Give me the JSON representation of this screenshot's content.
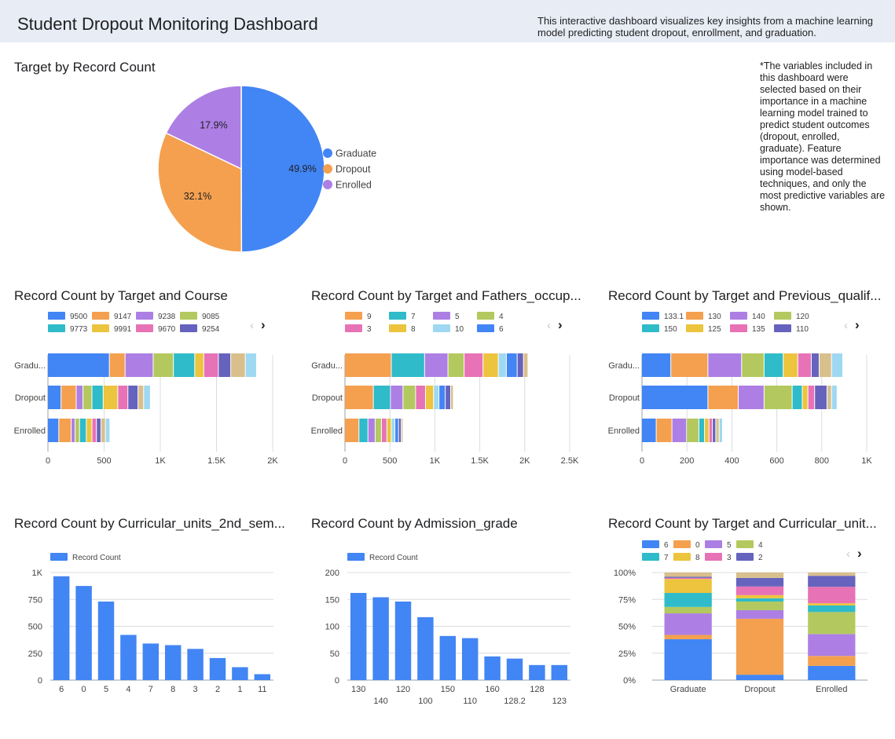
{
  "header": {
    "title": "Student Dropout Monitoring Dashboard",
    "description": "This interactive dashboard visualizes key insights from a machine learning model predicting student dropout, enrollment, and graduation."
  },
  "note": "*The variables included in this dashboard were selected based on their importance in a machine learning model trained to predict student outcomes (dropout, enrolled, graduate). Feature importance was determined using model-based techniques, and only the most predictive variables are shown.",
  "colors": {
    "blue": "#4285f4",
    "orange": "#f4a04f",
    "purple": "#ad7fe4",
    "olive": "#b3c95f",
    "teal": "#2fbbc9",
    "yellow": "#ecc43d",
    "pink": "#e772b6",
    "indigo": "#6563bd",
    "tan": "#d9bf8c",
    "lightblue": "#9fd8f2"
  },
  "chart_data": [
    {
      "id": "target_pie",
      "type": "pie",
      "title": "Target by Record Count",
      "slices": [
        {
          "label": "Graduate",
          "value": 49.9,
          "display": "49.9%",
          "color": "#4285f4"
        },
        {
          "label": "Dropout",
          "value": 32.1,
          "display": "32.1%",
          "color": "#f4a04f"
        },
        {
          "label": "Enrolled",
          "value": 17.9,
          "display": "17.9%",
          "color": "#ad7fe4"
        }
      ]
    },
    {
      "id": "course",
      "type": "bar",
      "stacked": true,
      "orientation": "horizontal",
      "title": "Record Count by Target and Course",
      "categories": [
        "Gradu...",
        "Dropout",
        "Enrolled"
      ],
      "ticks": [
        "0",
        "500",
        "1K",
        "1.5K",
        "2K"
      ],
      "xlim": [
        0,
        2000
      ],
      "legend": [
        "9500",
        "9147",
        "9238",
        "9085",
        "9773",
        "9991",
        "9670",
        "9254"
      ],
      "series": [
        {
          "name": "9500",
          "color": "#4285f4",
          "values": [
            550,
            120,
            100
          ]
        },
        {
          "name": "9147",
          "color": "#f4a04f",
          "values": [
            140,
            135,
            110
          ]
        },
        {
          "name": "9238",
          "color": "#ad7fe4",
          "values": [
            250,
            60,
            35
          ]
        },
        {
          "name": "9085",
          "color": "#b3c95f",
          "values": [
            180,
            80,
            40
          ]
        },
        {
          "name": "9773",
          "color": "#2fbbc9",
          "values": [
            190,
            100,
            60
          ]
        },
        {
          "name": "9991",
          "color": "#ecc43d",
          "values": [
            80,
            130,
            50
          ]
        },
        {
          "name": "9670",
          "color": "#e772b6",
          "values": [
            130,
            90,
            40
          ]
        },
        {
          "name": "9254",
          "color": "#6563bd",
          "values": [
            110,
            90,
            40
          ]
        },
        {
          "color": "#d9bf8c",
          "values": [
            130,
            50,
            40
          ]
        },
        {
          "color": "#9fd8f2",
          "values": [
            100,
            60,
            40
          ]
        }
      ]
    },
    {
      "id": "fathers",
      "type": "bar",
      "stacked": true,
      "orientation": "horizontal",
      "title": "Record Count by Target and Fathers_occup...",
      "categories": [
        "Gradu...",
        "Dropout",
        "Enrolled"
      ],
      "ticks": [
        "0",
        "500",
        "1K",
        "1.5K",
        "2K",
        "2.5K"
      ],
      "xlim": [
        0,
        2500
      ],
      "legend": [
        "9",
        "7",
        "5",
        "4",
        "3",
        "8",
        "10",
        "6"
      ],
      "series": [
        {
          "name": "9",
          "color": "#f4a04f",
          "values": [
            520,
            320,
            160
          ]
        },
        {
          "name": "7",
          "color": "#2fbbc9",
          "values": [
            370,
            190,
            100
          ]
        },
        {
          "name": "5",
          "color": "#ad7fe4",
          "values": [
            260,
            140,
            80
          ]
        },
        {
          "name": "4",
          "color": "#b3c95f",
          "values": [
            180,
            140,
            70
          ]
        },
        {
          "name": "3",
          "color": "#e772b6",
          "values": [
            210,
            110,
            60
          ]
        },
        {
          "name": "8",
          "color": "#ecc43d",
          "values": [
            170,
            90,
            50
          ]
        },
        {
          "name": "10",
          "color": "#9fd8f2",
          "values": [
            90,
            60,
            40
          ]
        },
        {
          "name": "6",
          "color": "#4285f4",
          "values": [
            120,
            70,
            40
          ]
        },
        {
          "color": "#6563bd",
          "values": [
            70,
            60,
            30
          ]
        },
        {
          "color": "#d9bf8c",
          "values": [
            50,
            30,
            20
          ]
        }
      ]
    },
    {
      "id": "prevqual",
      "type": "bar",
      "stacked": true,
      "orientation": "horizontal",
      "title": "Record Count by Target and Previous_qualif...",
      "categories": [
        "Gradu...",
        "Dropout",
        "Enrolled"
      ],
      "ticks": [
        "0",
        "200",
        "400",
        "600",
        "800",
        "1K"
      ],
      "xlim": [
        0,
        1000
      ],
      "legend": [
        "133.1",
        "130",
        "140",
        "120",
        "150",
        "125",
        "135",
        "110"
      ],
      "series": [
        {
          "name": "133.1",
          "color": "#4285f4",
          "values": [
            130,
            295,
            65
          ]
        },
        {
          "name": "130",
          "color": "#f4a04f",
          "values": [
            165,
            135,
            70
          ]
        },
        {
          "name": "140",
          "color": "#ad7fe4",
          "values": [
            150,
            115,
            65
          ]
        },
        {
          "name": "120",
          "color": "#b3c95f",
          "values": [
            100,
            125,
            55
          ]
        },
        {
          "name": "150",
          "color": "#2fbbc9",
          "values": [
            85,
            45,
            25
          ]
        },
        {
          "name": "125",
          "color": "#ecc43d",
          "values": [
            65,
            25,
            20
          ]
        },
        {
          "name": "135",
          "color": "#e772b6",
          "values": [
            60,
            30,
            15
          ]
        },
        {
          "name": "110",
          "color": "#6563bd",
          "values": [
            35,
            55,
            15
          ]
        },
        {
          "color": "#d9bf8c",
          "values": [
            55,
            20,
            15
          ]
        },
        {
          "color": "#9fd8f2",
          "values": [
            50,
            25,
            15
          ]
        }
      ]
    },
    {
      "id": "cu2nd",
      "type": "bar",
      "title": "Record Count by Curricular_units_2nd_sem...",
      "legend": [
        "Record Count"
      ],
      "categories": [
        "6",
        "0",
        "5",
        "4",
        "7",
        "8",
        "3",
        "2",
        "1",
        "11"
      ],
      "values": [
        965,
        875,
        730,
        420,
        340,
        325,
        290,
        205,
        120,
        55
      ],
      "ticks": [
        "0",
        "250",
        "500",
        "750",
        "1K"
      ],
      "ylim": [
        0,
        1000
      ],
      "color": "#4285f4"
    },
    {
      "id": "admission",
      "type": "bar",
      "title": "Record Count by Admission_grade",
      "legend": [
        "Record Count"
      ],
      "categories": [
        "130",
        "140",
        "120",
        "100",
        "150",
        "110",
        "160",
        "128.2",
        "128",
        "123"
      ],
      "values": [
        162,
        154,
        146,
        117,
        82,
        78,
        44,
        40,
        28,
        28
      ],
      "ticks": [
        "0",
        "50",
        "100",
        "150",
        "200"
      ],
      "ylim": [
        0,
        200
      ],
      "color": "#4285f4"
    },
    {
      "id": "cu100",
      "type": "bar",
      "stacked": true,
      "percent": true,
      "title": "Record Count by Target and Curricular_unit...",
      "categories": [
        "Graduate",
        "Dropout",
        "Enrolled"
      ],
      "ticks": [
        "0%",
        "25%",
        "50%",
        "75%",
        "100%"
      ],
      "legend": [
        "6",
        "0",
        "5",
        "4",
        "7",
        "8",
        "3",
        "2"
      ],
      "series": [
        {
          "name": "6",
          "color": "#4285f4",
          "values": [
            38,
            5,
            13
          ]
        },
        {
          "name": "0",
          "color": "#f4a04f",
          "values": [
            4,
            52,
            9
          ]
        },
        {
          "name": "5",
          "color": "#ad7fe4",
          "values": [
            20,
            8,
            20
          ]
        },
        {
          "name": "4",
          "color": "#b3c95f",
          "values": [
            6,
            8,
            20
          ]
        },
        {
          "name": "7",
          "color": "#2fbbc9",
          "values": [
            13,
            3,
            6
          ]
        },
        {
          "name": "8",
          "color": "#ecc43d",
          "values": [
            13,
            3,
            2
          ]
        },
        {
          "name": "3",
          "color": "#e772b6",
          "values": [
            1,
            8,
            15
          ]
        },
        {
          "name": "2",
          "color": "#6563bd",
          "values": [
            1,
            8,
            10
          ]
        },
        {
          "color": "#d9bf8c",
          "values": [
            4,
            5,
            3
          ]
        }
      ]
    }
  ]
}
